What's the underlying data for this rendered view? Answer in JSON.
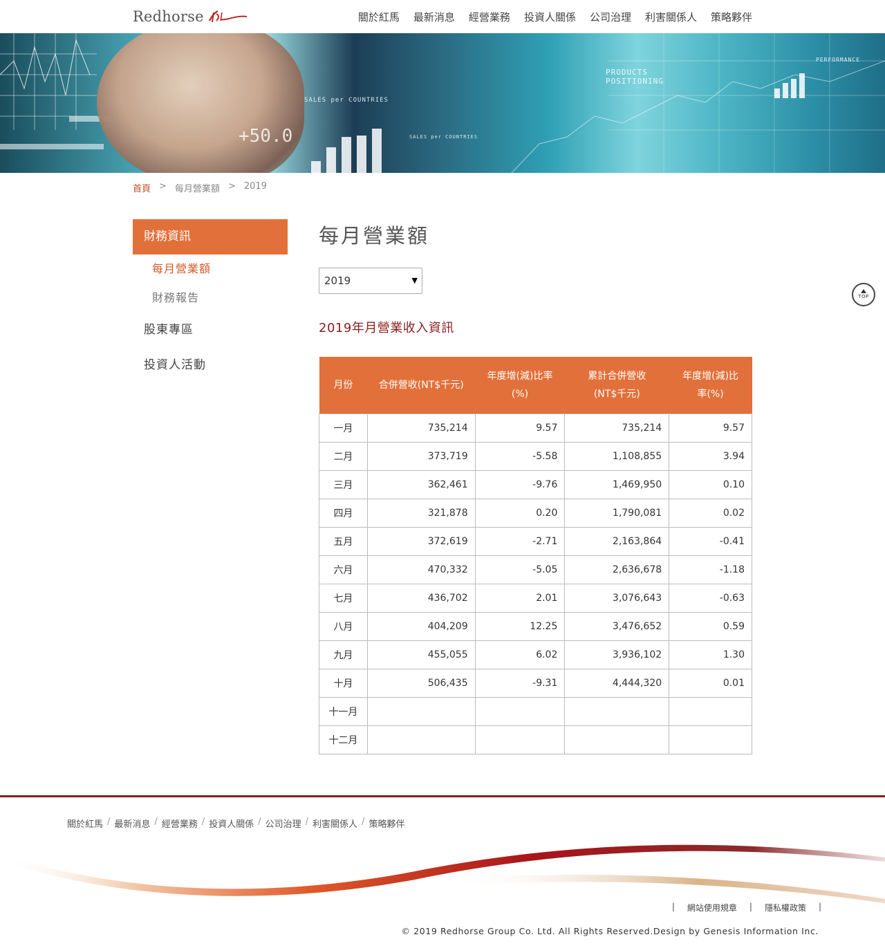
{
  "header": {
    "logo_text": "Redhorse",
    "nav": [
      "關於紅馬",
      "最新消息",
      "經營業務",
      "投資人關係",
      "公司治理",
      "利害關係人",
      "策略夥伴"
    ]
  },
  "banner": {
    "big_text": "+50.0",
    "small_text_1": "SALES per COUNTRIES",
    "small_text_2": "PRODUCTS POSITIONING",
    "small_text_3": "PERFORMANCE",
    "small_text_4": "SALES per COUNTRIES"
  },
  "breadcrumb": {
    "home": "首頁",
    "sep": ">",
    "level1": "每月營業額",
    "level2": "2019"
  },
  "sidebar": {
    "header": "財務資訊",
    "sub_items": [
      "每月營業額",
      "財務報告"
    ],
    "items": [
      "股東專區",
      "投資人活動"
    ]
  },
  "main": {
    "title": "每月營業額",
    "year_value": "2019",
    "section_title": "2019年月營業收入資訊",
    "columns": [
      "月份",
      "合併營收(NT$千元)",
      "年度增(減)比率\n(%)",
      "累計合併營收\n(NT$千元)",
      "年度增(減)比\n率(%)"
    ],
    "rows": [
      [
        "一月",
        "735,214",
        "9.57",
        "735,214",
        "9.57"
      ],
      [
        "二月",
        "373,719",
        "-5.58",
        "1,108,855",
        "3.94"
      ],
      [
        "三月",
        "362,461",
        "-9.76",
        "1,469,950",
        "0.10"
      ],
      [
        "四月",
        "321,878",
        "0.20",
        "1,790,081",
        "0.02"
      ],
      [
        "五月",
        "372,619",
        "-2.71",
        "2,163,864",
        "-0.41"
      ],
      [
        "六月",
        "470,332",
        "-5.05",
        "2,636,678",
        "-1.18"
      ],
      [
        "七月",
        "436,702",
        "2.01",
        "3,076,643",
        "-0.63"
      ],
      [
        "八月",
        "404,209",
        "12.25",
        "3,476,652",
        "0.59"
      ],
      [
        "九月",
        "455,055",
        "6.02",
        "3,936,102",
        "1.30"
      ],
      [
        "十月",
        "506,435",
        "-9.31",
        "4,444,320",
        "0.01"
      ],
      [
        "十一月",
        "",
        "",
        "",
        ""
      ],
      [
        "十二月",
        "",
        "",
        "",
        ""
      ]
    ]
  },
  "top_button": {
    "label": "TOP"
  },
  "footer": {
    "nav": [
      "關於紅馬",
      "最新消息",
      "經營業務",
      "投資人關係",
      "公司治理",
      "利害關係人",
      "策略夥伴"
    ],
    "nav_sep": "/",
    "legal": [
      "網站使用規章",
      "隱私權政策"
    ],
    "copyright": "© 2019 Redhorse Group Co. Ltd. All Rights Reserved.Design by Genesis Information Inc."
  },
  "colors": {
    "accent": "#e2703a",
    "brand_dark_red": "#8a1b1b",
    "link_red": "#d35a2a"
  }
}
